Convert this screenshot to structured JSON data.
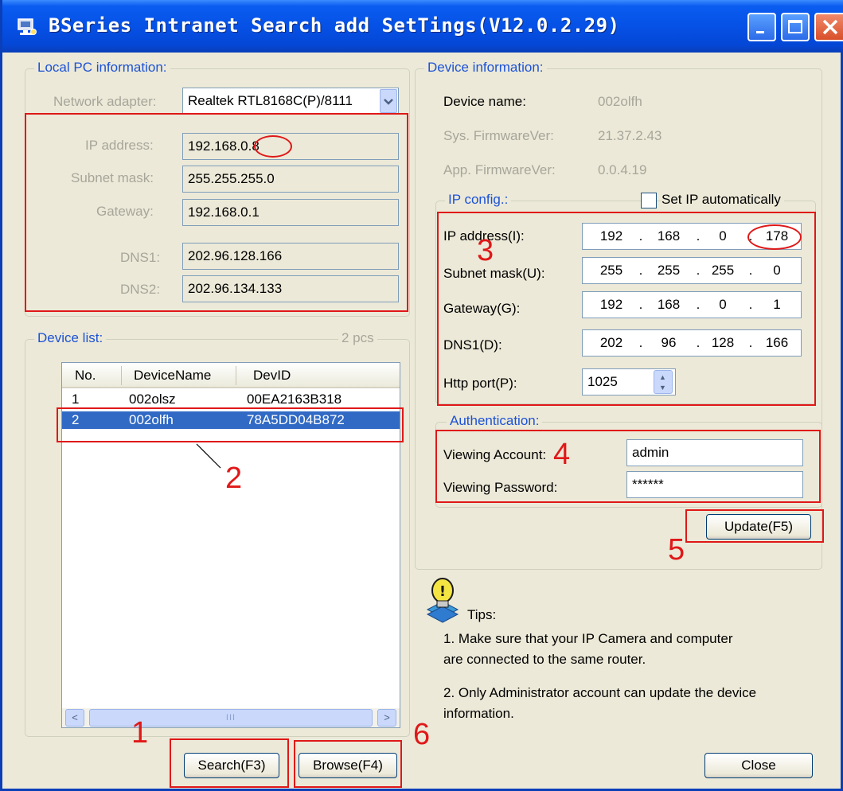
{
  "window": {
    "title": "BSeries Intranet Search add  SetTings(V12.0.2.29)"
  },
  "local_pc": {
    "legend": "Local PC information:",
    "network_adapter_label": "Network adapter:",
    "network_adapter_value": "Realtek RTL8168C(P)/8111",
    "ip_label": "IP address:",
    "ip_value": "192.168.0.8",
    "subnet_label": "Subnet mask:",
    "subnet_value": "255.255.255.0",
    "gateway_label": "Gateway:",
    "gateway_value": "192.168.0.1",
    "dns1_label": "DNS1:",
    "dns1_value": "202.96.128.166",
    "dns2_label": "DNS2:",
    "dns2_value": "202.96.134.133"
  },
  "device_list": {
    "legend": "Device list:",
    "count": "2 pcs",
    "columns": [
      "No.",
      "DeviceName",
      "DevID"
    ],
    "rows": [
      {
        "no": "1",
        "name": "002olsz",
        "id": "00EA2163B318"
      },
      {
        "no": "2",
        "name": "002olfh",
        "id": "78A5DD04B872"
      }
    ],
    "selected_row": 2,
    "scroll_thumb_glyph": "III",
    "scroll_left_glyph": "<",
    "scroll_right_glyph": ">"
  },
  "device_info": {
    "legend": "Device information:",
    "name_label": "Device name:",
    "name_value": "002olfh",
    "sys_fw_label": "Sys. FirmwareVer:",
    "sys_fw_value": "21.37.2.43",
    "app_fw_label": "App. FirmwareVer:",
    "app_fw_value": "0.0.4.19"
  },
  "ip_config": {
    "legend": "IP config.:",
    "auto_label": "Set IP automatically",
    "auto_checked": false,
    "ip_label": "IP address(I):",
    "ip": [
      "192",
      "168",
      "0",
      "178"
    ],
    "subnet_label": "Subnet mask(U):",
    "subnet": [
      "255",
      "255",
      "255",
      "0"
    ],
    "gateway_label": "Gateway(G):",
    "gateway": [
      "192",
      "168",
      "0",
      "1"
    ],
    "dns1_label": "DNS1(D):",
    "dns1": [
      "202",
      "96",
      "128",
      "166"
    ],
    "http_label": "Http port(P):",
    "http_port": "1025"
  },
  "auth": {
    "legend": "Authentication:",
    "account_label": "Viewing Account:",
    "account_value": "admin",
    "password_label": "Viewing Password:",
    "password_value": "******"
  },
  "buttons": {
    "update": "Update(F5)",
    "search": "Search(F3)",
    "browse": "Browse(F4)",
    "close": "Close"
  },
  "tips": {
    "title": "Tips:",
    "tip1_line1": "1. Make sure  that your IP Camera and computer",
    "tip1_line2": "are connected to the same router.",
    "tip2_line1": "2. Only Administrator account can update the device",
    "tip2_line2": "information."
  },
  "annotations": {
    "n1": "1",
    "n2": "2",
    "n3": "3",
    "n4": "4",
    "n5": "5",
    "n6": "6",
    "color": "#e01818"
  },
  "colors": {
    "titlebar": "#0651e6",
    "window_bg": "#ece9d8",
    "legend_text": "#1c52d6",
    "selection": "#316ac5"
  }
}
